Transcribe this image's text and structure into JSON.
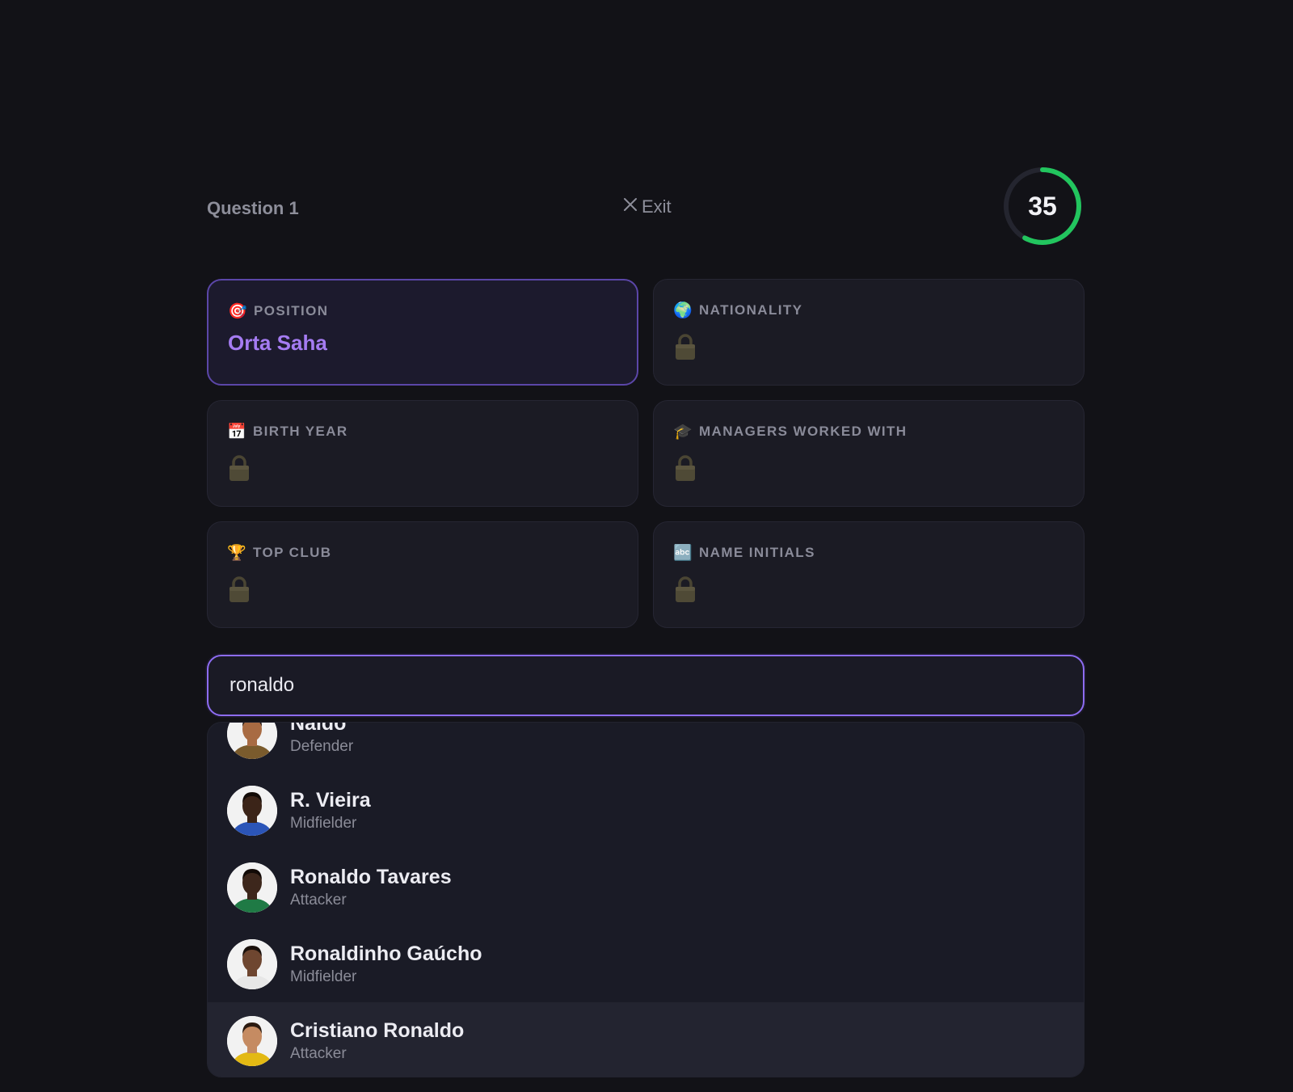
{
  "header": {
    "question_label": "Question 1",
    "exit_label": "Exit",
    "timer_value": "35",
    "timer_progress": 0.58
  },
  "colors": {
    "accent": "#8d6cf2",
    "revealed_text": "#a57cf2",
    "timer_ring": "#22c55e",
    "background": "#121217"
  },
  "cards": [
    {
      "icon": "target-icon",
      "emoji": "🎯",
      "label": "POSITION",
      "value": "Orta Saha",
      "revealed": true
    },
    {
      "icon": "globe-icon",
      "emoji": "🌍",
      "label": "NATIONALITY",
      "value": "",
      "revealed": false
    },
    {
      "icon": "calendar-icon",
      "emoji": "📅",
      "label": "BIRTH YEAR",
      "value": "",
      "revealed": false
    },
    {
      "icon": "graduation-cap-icon",
      "emoji": "🎓",
      "label": "MANAGERS WORKED WITH",
      "value": "",
      "revealed": false
    },
    {
      "icon": "trophy-icon",
      "emoji": "🏆",
      "label": "TOP CLUB",
      "value": "",
      "revealed": false
    },
    {
      "icon": "abc-icon",
      "emoji": "🔤",
      "label": "NAME INITIALS",
      "value": "",
      "revealed": false
    }
  ],
  "search": {
    "value": "ronaldo",
    "placeholder": ""
  },
  "results": [
    {
      "name": "Naldo",
      "role": "Defender",
      "skin": "#a86b43",
      "hair": "#1e1410",
      "shirt": "#7a5b2d"
    },
    {
      "name": "R. Vieira",
      "role": "Midfielder",
      "skin": "#3b2418",
      "hair": "#130b07",
      "shirt": "#2b55b8"
    },
    {
      "name": "Ronaldo Tavares",
      "role": "Attacker",
      "skin": "#3d271c",
      "hair": "#120a06",
      "shirt": "#1f7a45"
    },
    {
      "name": "Ronaldinho Gaúcho",
      "role": "Midfielder",
      "skin": "#6e4630",
      "hair": "#1a110c",
      "shirt": "#e7e7e7"
    },
    {
      "name": "Cristiano Ronaldo",
      "role": "Attacker",
      "skin": "#c58b62",
      "hair": "#2b1a10",
      "shirt": "#e3b913"
    }
  ]
}
